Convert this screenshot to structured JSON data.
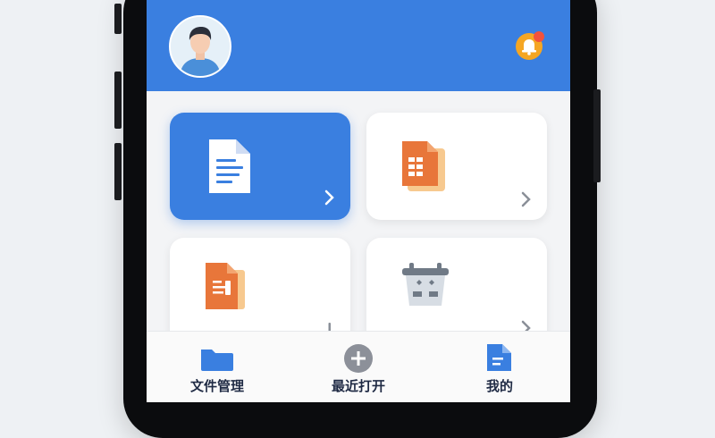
{
  "header": {
    "bg_color": "#3a7fe0",
    "avatar_icon": "user-avatar",
    "notification_icon": "bell-icon",
    "notification_badge_color": "#f2523c"
  },
  "tiles": [
    {
      "icon": "document-icon",
      "active": true
    },
    {
      "icon": "spreadsheet-icon",
      "active": false
    },
    {
      "icon": "presentation-icon",
      "active": false
    },
    {
      "icon": "calendar-basket-icon",
      "active": false
    }
  ],
  "bottom_nav": {
    "items": [
      {
        "label": "文件管理",
        "icon": "folder-icon"
      },
      {
        "label": "最近打开",
        "icon": "plus-circle-icon"
      },
      {
        "label": "我的",
        "icon": "profile-doc-icon"
      }
    ]
  }
}
